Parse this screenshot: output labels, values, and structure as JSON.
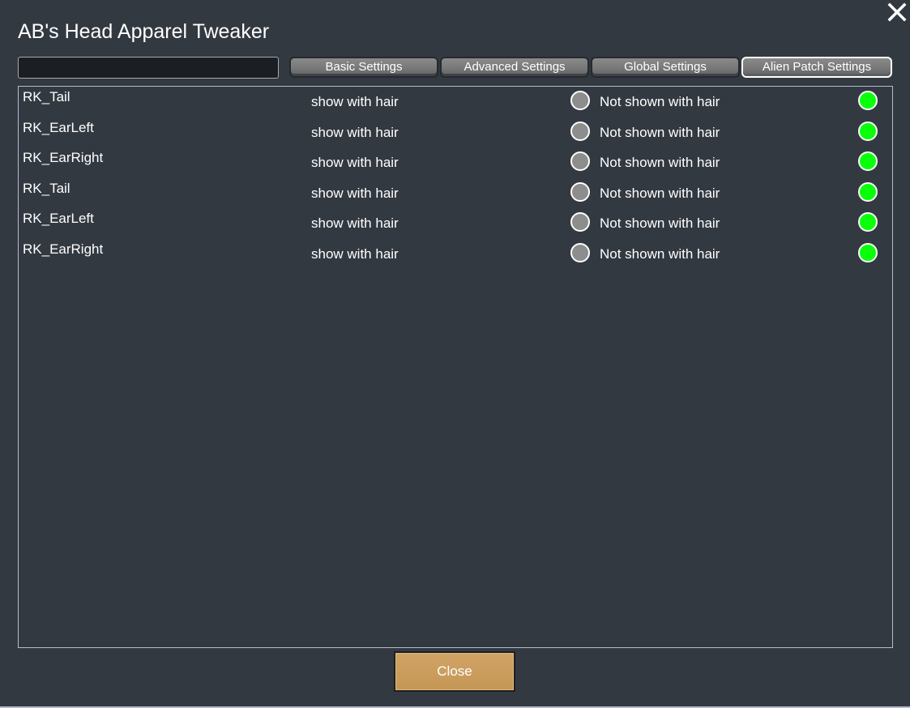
{
  "window": {
    "title": "AB's Head Apparel Tweaker",
    "close_icon": "close-x-icon"
  },
  "search": {
    "value": "",
    "placeholder": ""
  },
  "tabs": [
    {
      "label": "Basic Settings",
      "active": false
    },
    {
      "label": "Advanced Settings",
      "active": false
    },
    {
      "label": "Global Settings",
      "active": false
    },
    {
      "label": "Alien Patch Settings",
      "active": true
    }
  ],
  "options": {
    "show_label": "show with hair",
    "hide_label": "Not shown with hair"
  },
  "items": [
    {
      "name": "RK_Tail",
      "show_with_hair": false,
      "not_shown_with_hair": true
    },
    {
      "name": "RK_EarLeft",
      "show_with_hair": false,
      "not_shown_with_hair": true
    },
    {
      "name": "RK_EarRight",
      "show_with_hair": false,
      "not_shown_with_hair": true
    },
    {
      "name": "RK_Tail",
      "show_with_hair": false,
      "not_shown_with_hair": true
    },
    {
      "name": "RK_EarLeft",
      "show_with_hair": false,
      "not_shown_with_hair": true
    },
    {
      "name": "RK_EarRight",
      "show_with_hair": false,
      "not_shown_with_hair": true
    }
  ],
  "footer": {
    "close_label": "Close"
  },
  "colors": {
    "background": "#333941",
    "radio_selected": "#0aff0a",
    "radio_unselected": "#8d8d8d",
    "close_button": "#c99a5a"
  }
}
